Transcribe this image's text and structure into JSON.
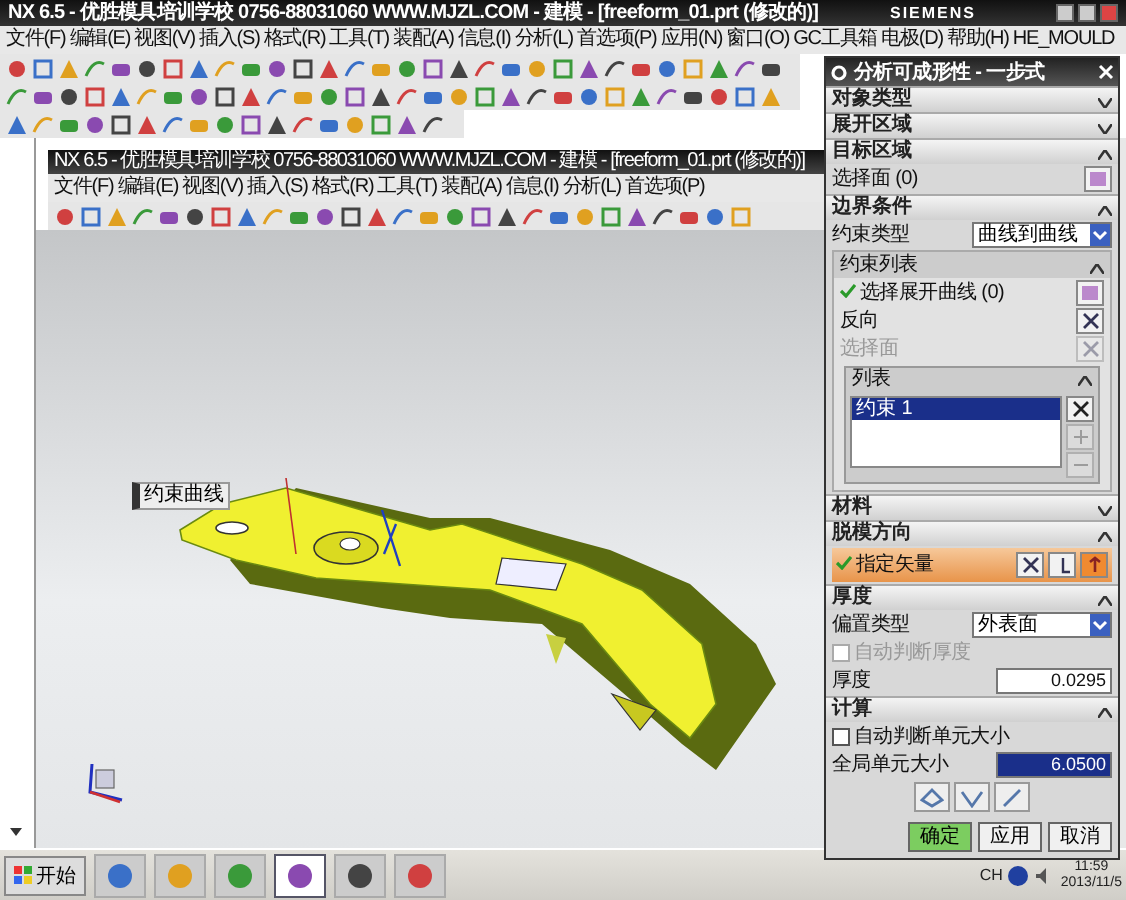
{
  "window": {
    "title": "NX 6.5 - 优胜模具培训学校 0756-88031060 WWW.MJZL.COM - 建模 - [freeform_01.prt (修改的)]",
    "brand": "SIEMENS"
  },
  "menu": [
    "文件(F)",
    "编辑(E)",
    "视图(V)",
    "插入(S)",
    "格式(R)",
    "工具(T)",
    "装配(A)",
    "信息(I)",
    "分析(L)",
    "首选项(P)",
    "应用(N)",
    "窗口(O)",
    "GC工具箱",
    "电极(D)",
    "帮助(H)",
    "HE_MOULD"
  ],
  "inner_window": {
    "title": "NX 6.5 - 优胜模具培训学校 0756-88031060 WWW.MJZL.COM - 建模 - [freeform_01.prt (修改的)]",
    "menu": [
      "文件(F)",
      "编辑(E)",
      "视图(V)",
      "插入(S)",
      "格式(R)",
      "工具(T)",
      "装配(A)",
      "信息(I)",
      "分析(L)",
      "首选项(P)"
    ]
  },
  "viewport": {
    "tag": "约束曲线"
  },
  "dialog": {
    "title": "分析可成形性 - 一步式",
    "sections": [
      {
        "title": "对象类型",
        "expanded": false
      },
      {
        "title": "展开区域",
        "expanded": false
      },
      {
        "title": "目标区域",
        "expanded": true,
        "rows": [
          {
            "kind": "select",
            "label": "选择面 (0)",
            "done": false
          }
        ]
      },
      {
        "title": "边界条件",
        "expanded": true,
        "rows": [
          {
            "kind": "dropdown",
            "label": "约束类型",
            "value": "曲线到曲线"
          },
          {
            "kind": "group",
            "title": "约束列表",
            "expanded": true,
            "rows": [
              {
                "kind": "select",
                "label": "选择展开曲线 (0)",
                "done": true
              },
              {
                "kind": "action",
                "label": "反向",
                "disabled": false
              },
              {
                "kind": "action",
                "label": "选择面",
                "disabled": true
              },
              {
                "kind": "list",
                "title": "列表",
                "items": [
                  {
                    "label": "约束 1",
                    "selected": true
                  }
                ]
              }
            ]
          }
        ]
      },
      {
        "title": "材料",
        "expanded": false
      },
      {
        "title": "脱模方向",
        "expanded": true,
        "rows": [
          {
            "kind": "vector",
            "label": "指定矢量",
            "done": true,
            "active": true
          }
        ]
      },
      {
        "title": "厚度",
        "expanded": true,
        "rows": [
          {
            "kind": "dropdown",
            "label": "偏置类型",
            "value": "外表面"
          },
          {
            "kind": "check",
            "label": "自动判断厚度",
            "checked": false,
            "disabled": true
          },
          {
            "kind": "field",
            "label": "厚度",
            "value": "0.0295",
            "highlighted": false
          }
        ]
      },
      {
        "title": "计算",
        "expanded": true,
        "rows": [
          {
            "kind": "check",
            "label": "自动判断单元大小",
            "checked": false,
            "disabled": false
          },
          {
            "kind": "field",
            "label": "全局单元大小",
            "value": "6.0500",
            "highlighted": true
          },
          {
            "kind": "icons"
          }
        ]
      }
    ],
    "buttons": [
      {
        "label": "确定",
        "default": true
      },
      {
        "label": "应用",
        "default": false
      },
      {
        "label": "取消",
        "default": false
      }
    ]
  },
  "taskbar": {
    "start": "开始",
    "language": "CH",
    "time": "11:59",
    "date": "2013/11/5",
    "apps": [
      {
        "selected": false
      },
      {
        "selected": false
      },
      {
        "selected": false
      },
      {
        "selected": true
      },
      {
        "selected": false
      },
      {
        "selected": false
      }
    ]
  }
}
